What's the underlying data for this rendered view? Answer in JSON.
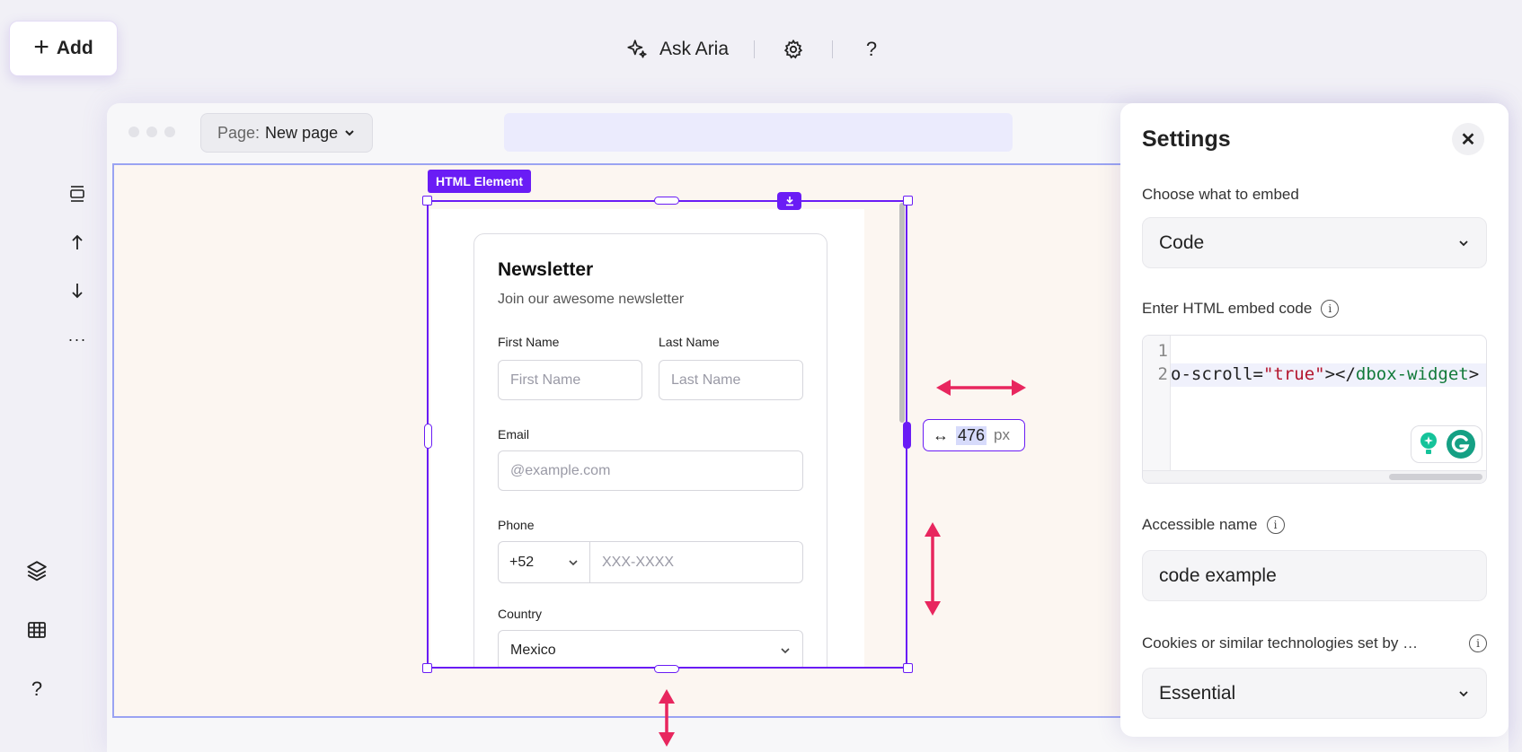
{
  "toolbar": {
    "add_label": "Add",
    "ask_aria_label": "Ask Aria",
    "help_label": "?"
  },
  "browser": {
    "page_label": "Page:",
    "page_value": "New page"
  },
  "element": {
    "tag_label": "HTML Element",
    "width_value": "476",
    "width_unit": "px"
  },
  "form": {
    "title": "Newsletter",
    "subtitle": "Join our awesome newsletter",
    "first_name_label": "First Name",
    "first_name_placeholder": "First Name",
    "last_name_label": "Last Name",
    "last_name_placeholder": "Last Name",
    "email_label": "Email",
    "email_placeholder": "@example.com",
    "phone_label": "Phone",
    "phone_code": "+52",
    "phone_placeholder": "XXX-XXXX",
    "country_label": "Country",
    "country_value": "Mexico"
  },
  "settings": {
    "title": "Settings",
    "embed_label": "Choose what to embed",
    "embed_value": "Code",
    "code_label": "Enter HTML embed code",
    "code_line_numbers": [
      "1",
      "2"
    ],
    "code_part_1": "o-scroll=",
    "code_part_2": "\"true\"",
    "code_part_3": "></",
    "code_part_4": "dbox-widget",
    "code_part_5": ">",
    "accessible_label": "Accessible name",
    "accessible_value": "code example",
    "cookies_label": "Cookies or similar technologies set by …",
    "cookies_value": "Essential"
  },
  "sidebar": {
    "help_label": "?"
  },
  "colors": {
    "accent": "#6a1cf5",
    "guide_arrow": "#e8265e",
    "canvas_bg": "#fcf6f1"
  }
}
